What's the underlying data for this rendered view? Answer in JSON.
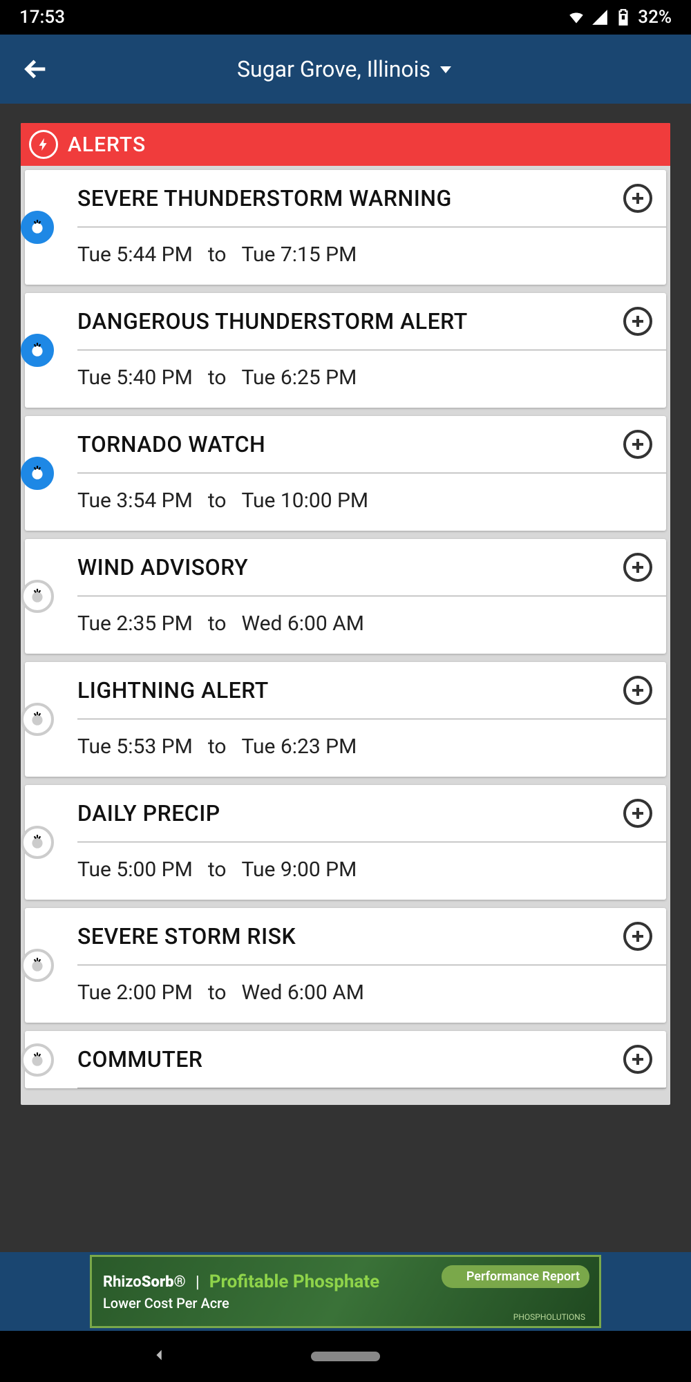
{
  "status": {
    "time": "17:53",
    "battery": "32%"
  },
  "header": {
    "location": "Sugar Grove, Illinois"
  },
  "alerts": {
    "heading": "ALERTS",
    "to_label": "to",
    "items": [
      {
        "title": "SEVERE THUNDERSTORM WARNING",
        "from": "Tue 5:44 PM",
        "to": "Tue 7:15 PM",
        "active": true
      },
      {
        "title": "DANGEROUS THUNDERSTORM ALERT",
        "from": "Tue 5:40 PM",
        "to": "Tue 6:25 PM",
        "active": true
      },
      {
        "title": "TORNADO WATCH",
        "from": "Tue 3:54 PM",
        "to": "Tue 10:00 PM",
        "active": true
      },
      {
        "title": "WIND ADVISORY",
        "from": "Tue 2:35 PM",
        "to": "Wed 6:00 AM",
        "active": false
      },
      {
        "title": "LIGHTNING ALERT",
        "from": "Tue 5:53 PM",
        "to": "Tue 6:23 PM",
        "active": false
      },
      {
        "title": "DAILY PRECIP",
        "from": "Tue 5:00 PM",
        "to": "Tue 9:00 PM",
        "active": false
      },
      {
        "title": "SEVERE STORM RISK",
        "from": "Tue 2:00 PM",
        "to": "Wed 6:00 AM",
        "active": false
      },
      {
        "title": "COMMUTER",
        "from": "",
        "to": "",
        "active": false
      }
    ]
  },
  "ad": {
    "brand_prefix": "Rhizo",
    "brand_suffix": "Sorb",
    "headline": "Profitable Phosphate",
    "sub": "Lower Cost Per Acre",
    "cta": "Performance Report",
    "tag": "PHOSPHOLUTIONS"
  }
}
